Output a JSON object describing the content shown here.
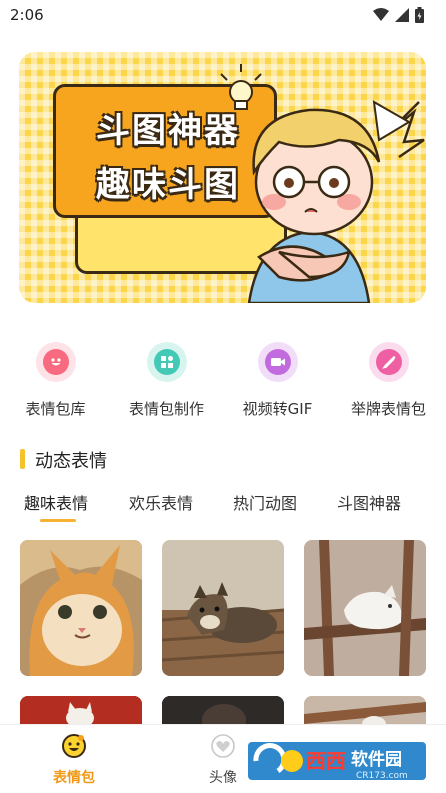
{
  "status_bar": {
    "time": "2:06",
    "icons": [
      "wifi-icon",
      "signal-icon",
      "battery-icon"
    ]
  },
  "banner": {
    "line1": "斗图神器",
    "line2": "趣味斗图"
  },
  "actions": [
    {
      "label": "表情包库",
      "icon": "smile-icon",
      "color": "#f76a80"
    },
    {
      "label": "表情包制作",
      "icon": "grid-icon",
      "color": "#43c9b6"
    },
    {
      "label": "视频转GIF",
      "icon": "video-icon",
      "color": "#c26bdf"
    },
    {
      "label": "举牌表情包",
      "icon": "pen-icon",
      "color": "#ef5fa4"
    }
  ],
  "section": {
    "title": "动态表情"
  },
  "tabs": [
    "趣味表情",
    "欢乐表情",
    "热门动图",
    "斗图神器"
  ],
  "active_tab": "趣味表情",
  "grid": [
    {
      "subject": "orange-cat"
    },
    {
      "subject": "puppy"
    },
    {
      "subject": "white-cat"
    },
    {
      "subject": "cats-red"
    },
    {
      "subject": "person-dark"
    },
    {
      "subject": "white-cat-2"
    }
  ],
  "bottom_nav": [
    {
      "label": "表情包",
      "icon": "emoji-face-icon",
      "active": true
    },
    {
      "label": "头像",
      "icon": "heart-avatar-icon",
      "active": false
    }
  ],
  "watermark": {
    "text1": "西西",
    "text2": "软件园",
    "url": "CR173.com"
  },
  "colors": {
    "accent": "#f5b233",
    "active_nav": "#f09a18",
    "banner_bg": "#fcd64a"
  }
}
